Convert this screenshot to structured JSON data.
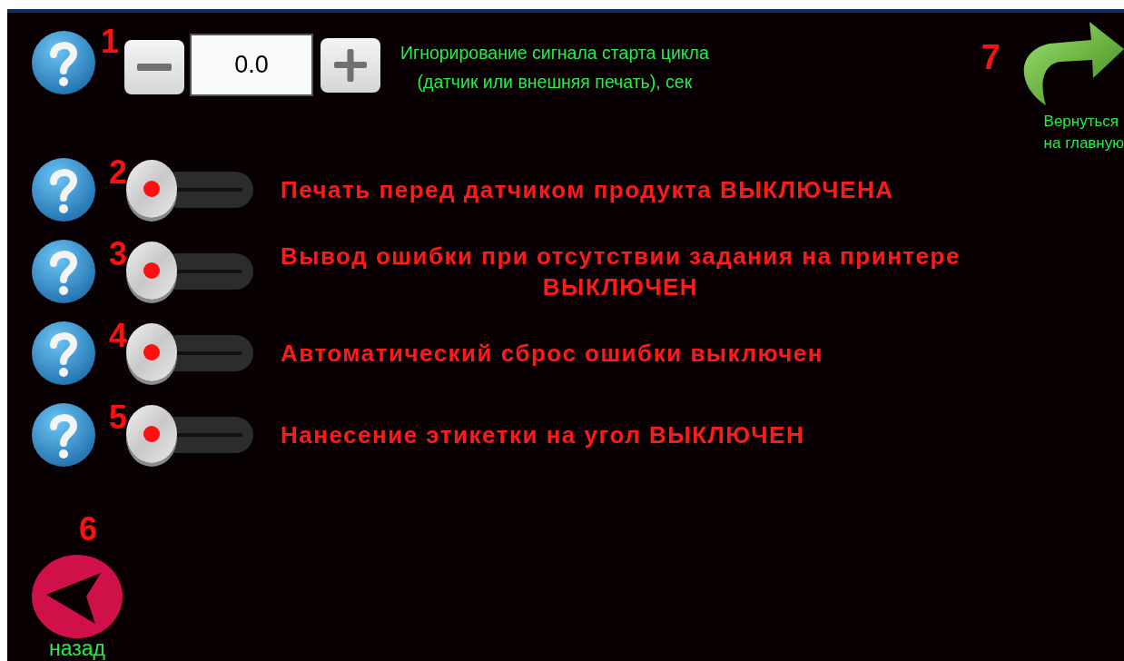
{
  "timer": {
    "marker": "1",
    "value": "0.0",
    "label": "Игнорирование сигнала старта цикла\n(датчик или внешняя печать), сек"
  },
  "home": {
    "marker": "7",
    "label": "Вернуться\nна главную"
  },
  "toggles": [
    {
      "marker": "2",
      "on": false,
      "label": "Печать перед датчиком продукта ВЫКЛЮЧЕНА"
    },
    {
      "marker": "3",
      "on": false,
      "label": "Вывод ошибки при отсутствии задания на принтере\nВЫКЛЮЧЕН"
    },
    {
      "marker": "4",
      "on": false,
      "label": "Автоматический сброс ошибки выключен"
    },
    {
      "marker": "5",
      "on": false,
      "label": "Нанесение этикетки на угол ВЫКЛЮЧЕН"
    }
  ],
  "back": {
    "marker": "6",
    "label": "назад"
  }
}
